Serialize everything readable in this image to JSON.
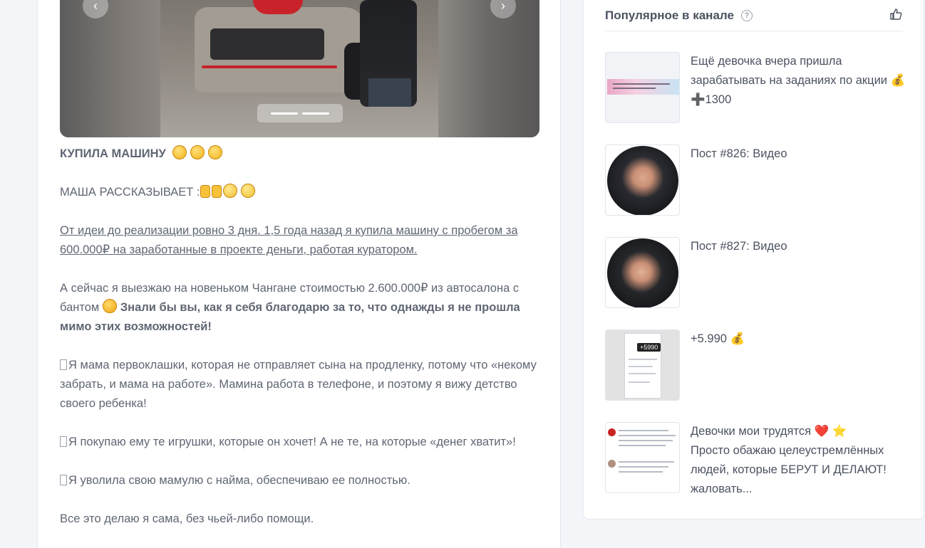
{
  "gallery": {
    "prev_icon": "chevron-left-icon",
    "next_icon": "chevron-right-icon",
    "prev_glyph": "‹",
    "next_glyph": "›"
  },
  "post": {
    "title": "КУПИЛА МАШИНУ",
    "intro": "МАША РАССКАЗЫВАЕТ :",
    "p1": "От идеи до реализации ровно 3 дня. 1,5 года назад я купила машину с пробегом за 600.000₽ на заработанные в проекте деньги, работая куратором.",
    "p2_start": "А сейчас я выезжаю на новеньком Чангане стоимостью 2.600.000₽ из автосалона с бантом ",
    "p2_bold": "Знали бы вы, как я себя благодарю за то, что однажды я не прошла мимо этих возможностей!",
    "p3": "Я мама первоклашки, которая не отправляет сына на продленку, потому что «некому забрать, и мама на работе». Мамина работа в телефоне, и поэтому я вижу детство своего ребенка!",
    "p4": "Я покупаю ему те игрушки, которые он хочет! А не те, на которые «денег хватит»!",
    "p5": "Я уволила свою мамулю с найма, обеспечиваю ее полностью.",
    "p6": "Все это делаю я сама, без чьей-либо помощи."
  },
  "sidebar": {
    "title": "Популярное в канале",
    "help_glyph": "?",
    "items": [
      {
        "text": "Ещё девочка вчера пришла зарабатывать на заданиях по акции 💰 ➕1300"
      },
      {
        "text": "Пост #826: Видео"
      },
      {
        "text": "Пост #827: Видео"
      },
      {
        "text": "+5.990 💰",
        "badge": "+5990"
      },
      {
        "text_line1": "Девочки мои трудятся ❤️ ⭐",
        "text_rest": "Просто обажаю целеустремлённых людей, которые БЕРУТ И ДЕЛАЮТ!",
        "more": "жаловать..."
      }
    ]
  }
}
